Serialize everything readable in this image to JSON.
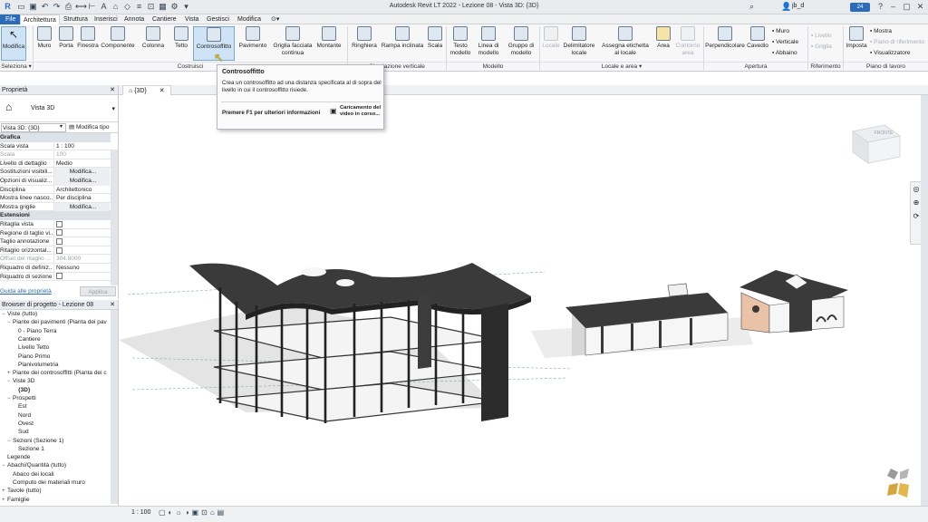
{
  "window": {
    "title": "Autodesk Revit LT 2022 - Lezione 08 - Vista 3D: {3D}",
    "user": "jb_d",
    "notif_count": "24"
  },
  "tabs": [
    "File",
    "Architettura",
    "Struttura",
    "Inserisci",
    "Annota",
    "Cantiere",
    "Vista",
    "Gestisci",
    "Modifica"
  ],
  "ribbon": {
    "modifica": "Modifica",
    "seleziona": "Seleziona ▾",
    "buttons": [
      {
        "label": "Muro",
        "icon": "wall-icon"
      },
      {
        "label": "Porta",
        "icon": "door-icon"
      },
      {
        "label": "Finestra",
        "icon": "window-icon"
      },
      {
        "label": "Componente",
        "icon": "component-icon"
      },
      {
        "label": "Colonna",
        "icon": "column-icon"
      },
      {
        "label": "Tetto",
        "icon": "roof-icon"
      },
      {
        "label": "Controsoffitto",
        "icon": "ceiling-icon"
      },
      {
        "label": "Pavimento",
        "icon": "floor-icon"
      },
      {
        "label": "Griglia facciata continua",
        "icon": "curtain-grid-icon"
      },
      {
        "label": "Montante",
        "icon": "mullion-icon"
      },
      {
        "label": "Ringhiera",
        "icon": "railing-icon"
      },
      {
        "label": "Rampa inclinata",
        "icon": "ramp-icon"
      },
      {
        "label": "Scala",
        "icon": "stair-icon"
      },
      {
        "label": "Testo modello",
        "icon": "model-text-icon"
      },
      {
        "label": "Linea di modello",
        "icon": "model-line-icon"
      },
      {
        "label": "Gruppo di modello",
        "icon": "model-group-icon"
      },
      {
        "label": "Locale",
        "icon": "room-icon"
      },
      {
        "label": "Delimitatore locale",
        "icon": "room-separator-icon"
      },
      {
        "label": "Assegna etichetta al locale",
        "icon": "tag-room-icon"
      },
      {
        "label": "Area",
        "icon": "area-icon"
      },
      {
        "label": "Contorno area",
        "icon": "area-boundary-icon"
      },
      {
        "label": "Perpendicolare",
        "icon": "perpendicular-icon"
      },
      {
        "label": "Cavedio",
        "icon": "shaft-icon"
      },
      {
        "label": "Imposta",
        "icon": "set-workplane-icon"
      }
    ],
    "small": {
      "muro": "Muro",
      "verticale": "Verticale",
      "abbaino": "Abbaino",
      "livello": "Livello",
      "griglia": "Griglia",
      "mostra": "Mostra",
      "piano_rif": "Piano di riferimento",
      "visualizzatore": "Visualizzatore"
    },
    "panels": {
      "costruisci": "Costruisci",
      "circolazione": "Circolazione verticale",
      "modello": "Modello",
      "locale_area": "Locale e area ▾",
      "apertura": "Apertura",
      "riferimento": "Riferimento",
      "piano_lavoro": "Piano di lavoro"
    }
  },
  "tooltip": {
    "title": "Controsoffitto",
    "body": "Crea un controsoffitto ad una distanza specificata al di sopra del livello in cui il controsoffitto risiede.",
    "help": "Premere F1 per ulteriori informazioni",
    "video": "Caricamento del video in corso..."
  },
  "properties": {
    "title": "Proprietà",
    "type_name": "Vista 3D",
    "selector": "Vista 3D: {3D}",
    "edit_type": "Modifica tipo",
    "cat_grafica": "Grafica",
    "rows": [
      {
        "k": "Scala vista",
        "v": "1 : 100"
      },
      {
        "k": "Scala",
        "v": "100"
      },
      {
        "k": "Livello di dettaglio",
        "v": "Medio"
      },
      {
        "k": "Sostituzioni visibili...",
        "v": "Modifica..."
      },
      {
        "k": "Opzioni di visualiz...",
        "v": "Modifica..."
      },
      {
        "k": "Disciplina",
        "v": "Architettonico"
      },
      {
        "k": "Mostra linee nasco...",
        "v": "Per disciplina"
      },
      {
        "k": "Mostra griglie",
        "v": "Modifica..."
      }
    ],
    "cat_estensioni": "Estensioni",
    "ext_rows": [
      {
        "k": "Ritaglia vista"
      },
      {
        "k": "Regione di taglio vi..."
      },
      {
        "k": "Taglio annotazione"
      },
      {
        "k": "Ritaglio orizzontal..."
      }
    ],
    "offset_k": "Offset del ritaglio ...",
    "offset_v": "304.8000",
    "riquadro_k": "Riquadro di definiz...",
    "riquadro_v": "Nessuno",
    "riquadro2_k": "Riquadro di sezione",
    "help_link": "Guida alle proprietà",
    "apply": "Applica"
  },
  "browser": {
    "title": "Browser di progetto - Lezione 08",
    "items": [
      {
        "t": "Viste (tutto)",
        "lv": 0,
        "tg": "−"
      },
      {
        "t": "Piante dei pavimenti (Pianta dei pav",
        "lv": 1,
        "tg": "−"
      },
      {
        "t": "0 - Piano Terra",
        "lv": 2,
        "tg": ""
      },
      {
        "t": "Cantiere",
        "lv": 2,
        "tg": ""
      },
      {
        "t": "Livello Tetto",
        "lv": 2,
        "tg": ""
      },
      {
        "t": "Piano Primo",
        "lv": 2,
        "tg": ""
      },
      {
        "t": "Planivolumetria",
        "lv": 2,
        "tg": ""
      },
      {
        "t": "Piante dei controsoffitti (Pianta dei c",
        "lv": 1,
        "tg": "+"
      },
      {
        "t": "Viste 3D",
        "lv": 1,
        "tg": "−"
      },
      {
        "t": "{3D}",
        "lv": 2,
        "tg": ""
      },
      {
        "t": "Prospetti",
        "lv": 1,
        "tg": "−"
      },
      {
        "t": "Est",
        "lv": 2,
        "tg": ""
      },
      {
        "t": "Nord",
        "lv": 2,
        "tg": ""
      },
      {
        "t": "Ovest",
        "lv": 2,
        "tg": ""
      },
      {
        "t": "Sud",
        "lv": 2,
        "tg": ""
      },
      {
        "t": "Sezioni (Sezione 1)",
        "lv": 1,
        "tg": "−"
      },
      {
        "t": "Sezione 1",
        "lv": 2,
        "tg": ""
      },
      {
        "t": "Legende",
        "lv": 0,
        "tg": ""
      },
      {
        "t": "Abachi/Quantità (tutto)",
        "lv": 0,
        "tg": "−"
      },
      {
        "t": "Abaco dei locali",
        "lv": 1,
        "tg": ""
      },
      {
        "t": "Computo dei materiali muro",
        "lv": 1,
        "tg": ""
      },
      {
        "t": "Tavole (tutto)",
        "lv": 0,
        "tg": "+"
      },
      {
        "t": "Famiglie",
        "lv": 0,
        "tg": "+"
      }
    ]
  },
  "view": {
    "tab": "{3D}",
    "scale": "1 : 100",
    "viewcube": "FRONTE"
  },
  "colors": {
    "accent": "#2b6cb8",
    "ribbon_bg": "#f7f7f8",
    "building_dark": "#3a3a3a",
    "building_light": "#f2f2f2",
    "terracotta": "#e9c2a8"
  }
}
